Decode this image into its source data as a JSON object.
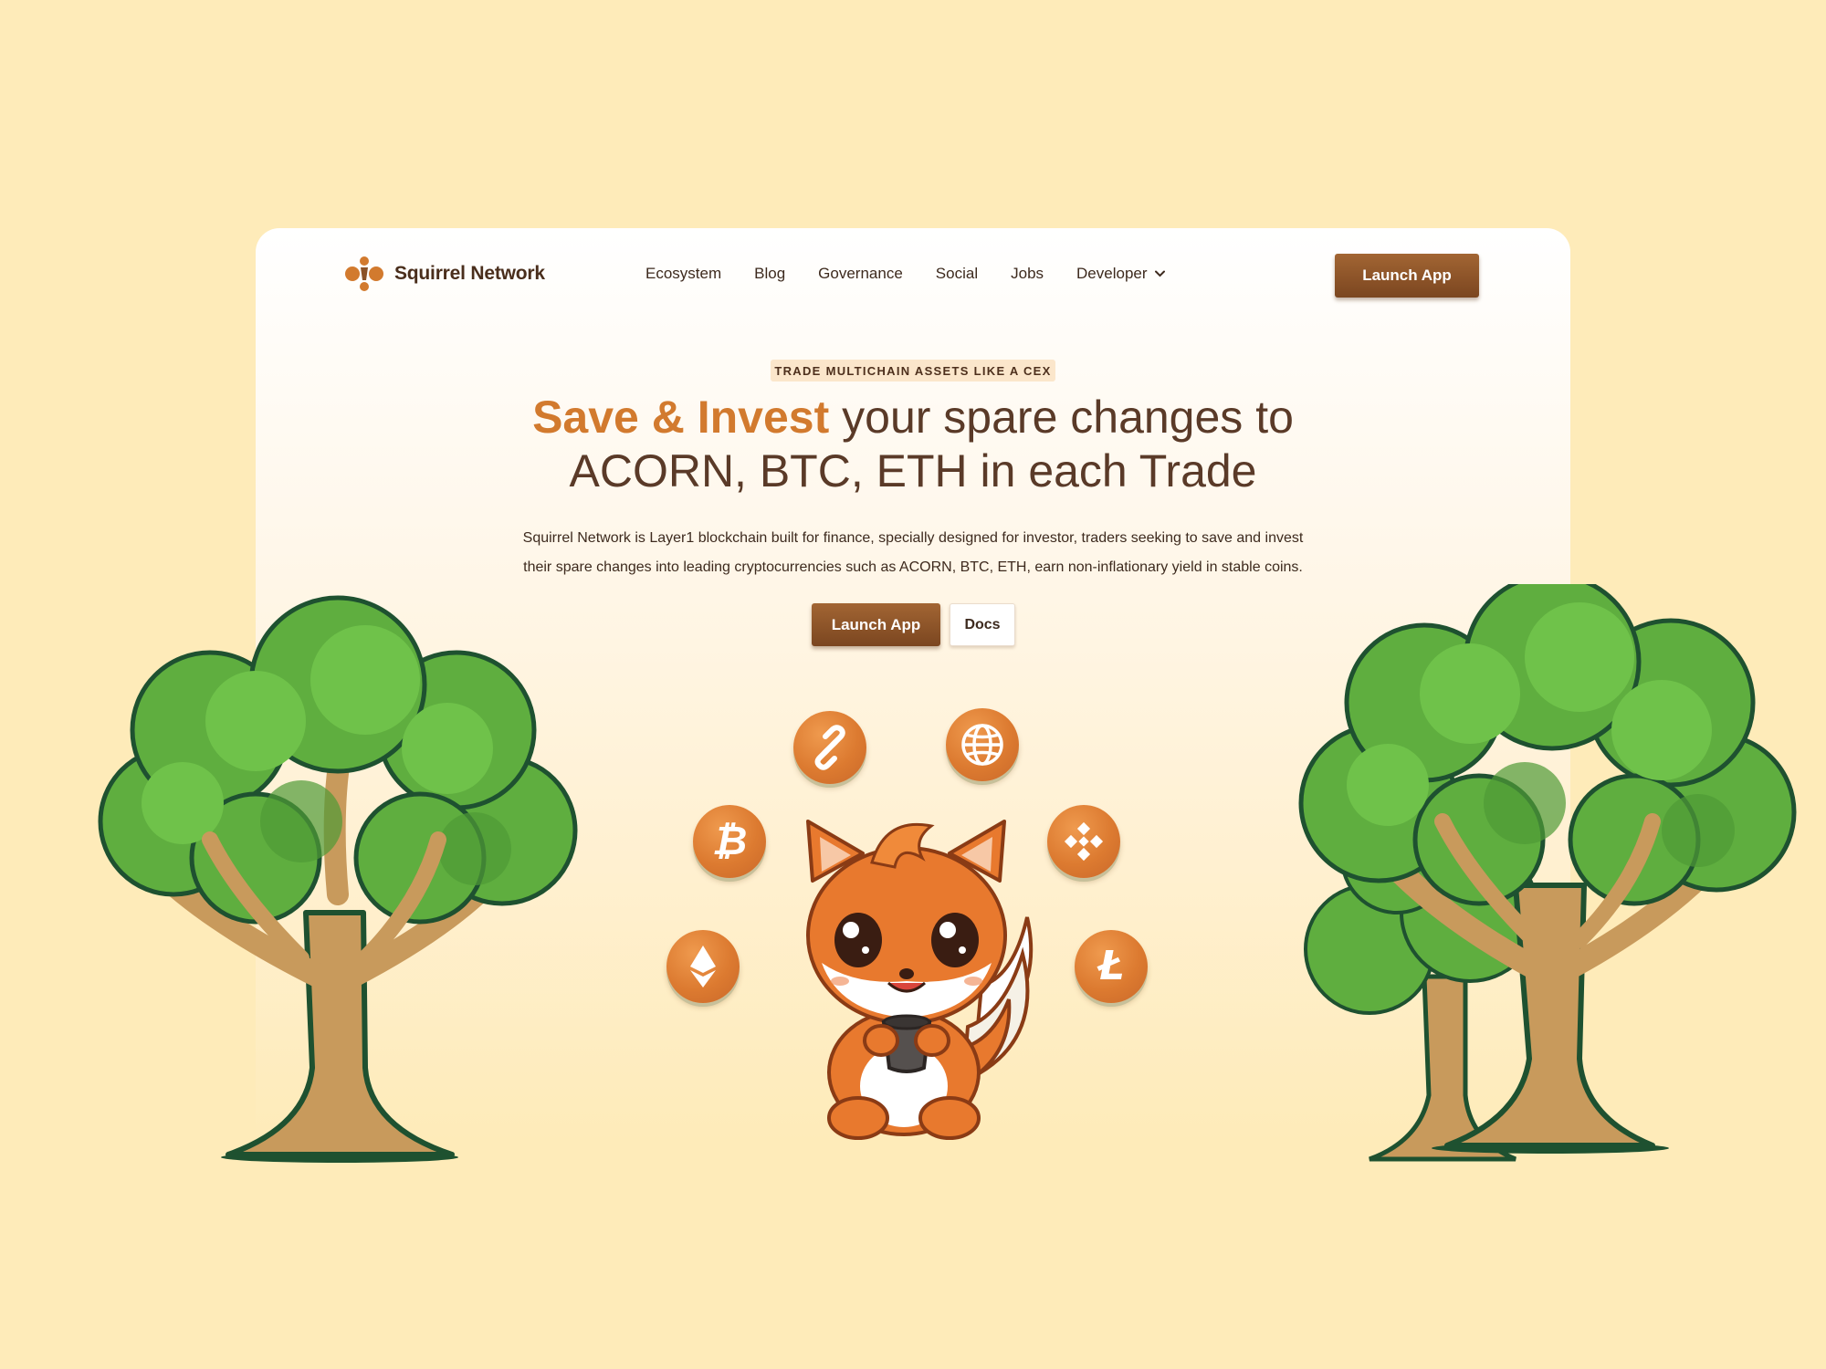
{
  "brand": {
    "name": "Squirrel Network",
    "accent_color": "#d27a2e",
    "button_color": "#8b5227",
    "background_color": "#feebb9"
  },
  "nav": {
    "items": [
      {
        "label": "Ecosystem"
      },
      {
        "label": "Blog"
      },
      {
        "label": "Governance"
      },
      {
        "label": "Social"
      },
      {
        "label": "Jobs"
      },
      {
        "label": "Developer",
        "has_dropdown": true
      }
    ],
    "launch_label": "Launch App"
  },
  "hero": {
    "badge": "TRADE MULTICHAIN ASSETS LIKE A CEX",
    "headline_accent": "Save & Invest",
    "headline_rest_line1": " your spare changes to",
    "headline_line2": "ACORN, BTC, ETH in each Trade",
    "subtext_line1": "Squirrel Network is Layer1 blockchain built for finance, specially designed for investor, traders seeking to save and invest",
    "subtext_line2": "their spare changes into leading cryptocurrencies such as ACORN, BTC, ETH, earn non-inflationary yield in stable coins.",
    "launch_label": "Launch App",
    "docs_label": "Docs"
  },
  "coins": [
    {
      "icon": "chain-link-icon"
    },
    {
      "icon": "globe-icon"
    },
    {
      "icon": "bitcoin-icon",
      "glyph": "₿"
    },
    {
      "icon": "bnb-icon"
    },
    {
      "icon": "ethereum-icon"
    },
    {
      "icon": "litecoin-icon",
      "glyph": "Ł"
    }
  ],
  "illustrations": [
    "tree-left",
    "tree-right",
    "squirrel-mascot"
  ]
}
